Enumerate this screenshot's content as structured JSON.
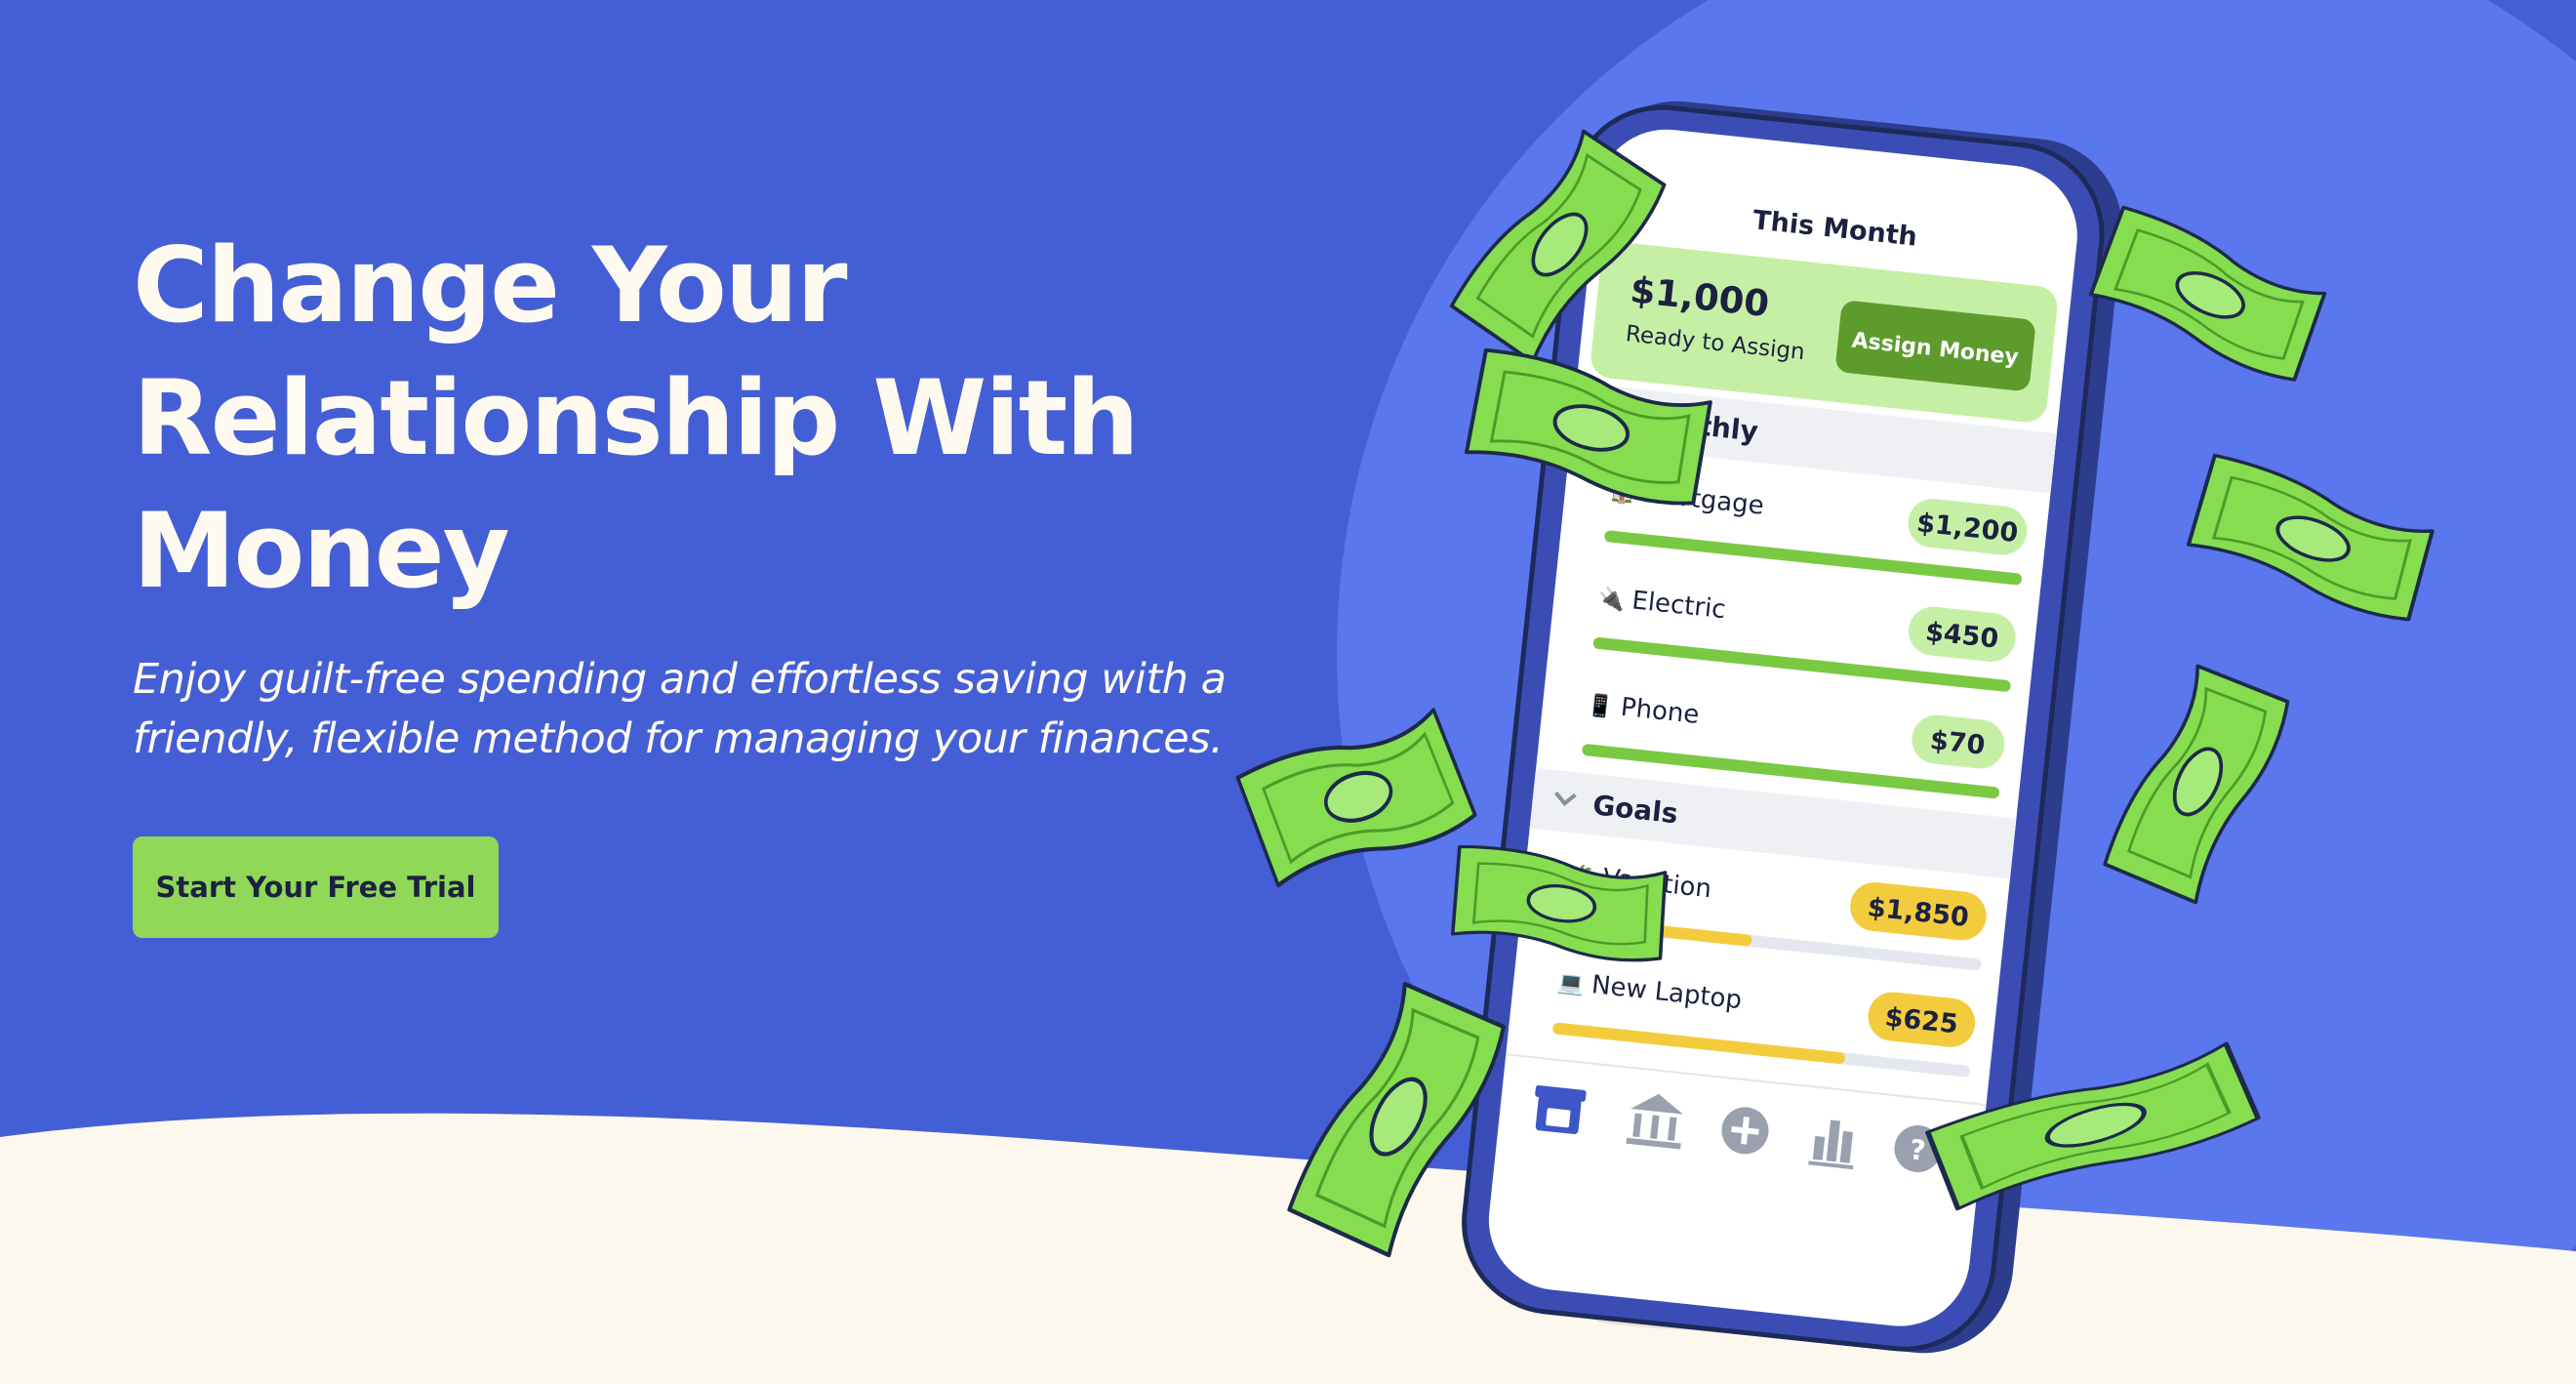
{
  "hero": {
    "title_lines": [
      "Change Your",
      "Relationship With",
      "Money"
    ],
    "subtitle_lines": [
      "Enjoy guilt-free spending and effortless saving with a",
      "friendly, flexible method for managing your finances."
    ],
    "cta_label": "Start Your Free Trial"
  },
  "phone": {
    "header_title": "This Month",
    "ready": {
      "amount": "$1,000",
      "label": "Ready to Assign",
      "button_label": "Assign Money"
    },
    "groups": [
      {
        "name": "Monthly",
        "items": [
          {
            "icon": "house-icon",
            "name": "Mortgage",
            "amount": "$1,200",
            "progress": 1.0
          },
          {
            "icon": "plug-icon",
            "name": "Electric",
            "amount": "$450",
            "progress": 1.0
          },
          {
            "icon": "phone-icon",
            "name": "Phone",
            "amount": "$70",
            "progress": 1.0
          }
        ]
      },
      {
        "name": "Goals",
        "items": [
          {
            "icon": "palm-tree-icon",
            "name": "Vacation",
            "amount": "$1,850",
            "progress": 0.45
          },
          {
            "icon": "laptop-icon",
            "name": "New Laptop",
            "amount": "$625",
            "progress": 0.7
          }
        ]
      }
    ],
    "nav": [
      "budget-icon",
      "accounts-icon",
      "add-transaction-icon",
      "reports-icon",
      "help-icon"
    ]
  },
  "colors": {
    "background": "#445fd5",
    "circle": "#5b77ee",
    "ground": "#fcf8ee",
    "cta": "#8fd858",
    "funded_green": "#7ac943",
    "amount_green": "#c6efa6",
    "goal_yellow": "#f3cc3e",
    "assign_button": "#5d9b2d"
  }
}
